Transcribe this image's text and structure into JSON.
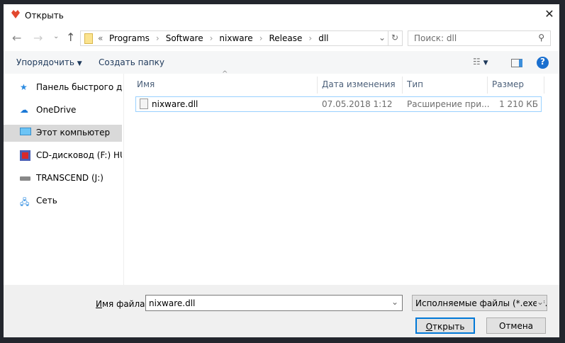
{
  "window": {
    "title": "Открыть"
  },
  "address": {
    "prefix": "«",
    "crumbs": [
      "Programs",
      "Software",
      "nixware",
      "Release",
      "dll"
    ]
  },
  "search": {
    "placeholder": "Поиск: dll"
  },
  "toolbar": {
    "organize": "Упорядочить",
    "new_folder": "Создать папку"
  },
  "sidebar": {
    "items": [
      {
        "label": "Панель быстрого доступа",
        "icon": "star-icon"
      },
      {
        "label": "OneDrive",
        "icon": "cloud-icon"
      },
      {
        "label": "Этот компьютер",
        "icon": "computer-icon",
        "selected": true
      },
      {
        "label": "CD-дисковод (F:) HUAWEI",
        "icon": "cd-drive-icon"
      },
      {
        "label": "TRANSCEND (J:)",
        "icon": "drive-icon"
      },
      {
        "label": "Сеть",
        "icon": "network-icon"
      }
    ]
  },
  "columns": [
    "Имя",
    "Дата изменения",
    "Тип",
    "Размер"
  ],
  "files": [
    {
      "name": "nixware.dll",
      "date": "07.05.2018 1:12",
      "type": "Расширение при...",
      "size": "1 210 КБ"
    }
  ],
  "footer": {
    "filename_label_u": "И",
    "filename_label_rest": "мя файла:",
    "filename_value": "nixware.dll",
    "filter": "Исполняемые файлы (*.exe *.",
    "open_u": "О",
    "open_rest": "ткрыть",
    "cancel": "Отмена"
  }
}
